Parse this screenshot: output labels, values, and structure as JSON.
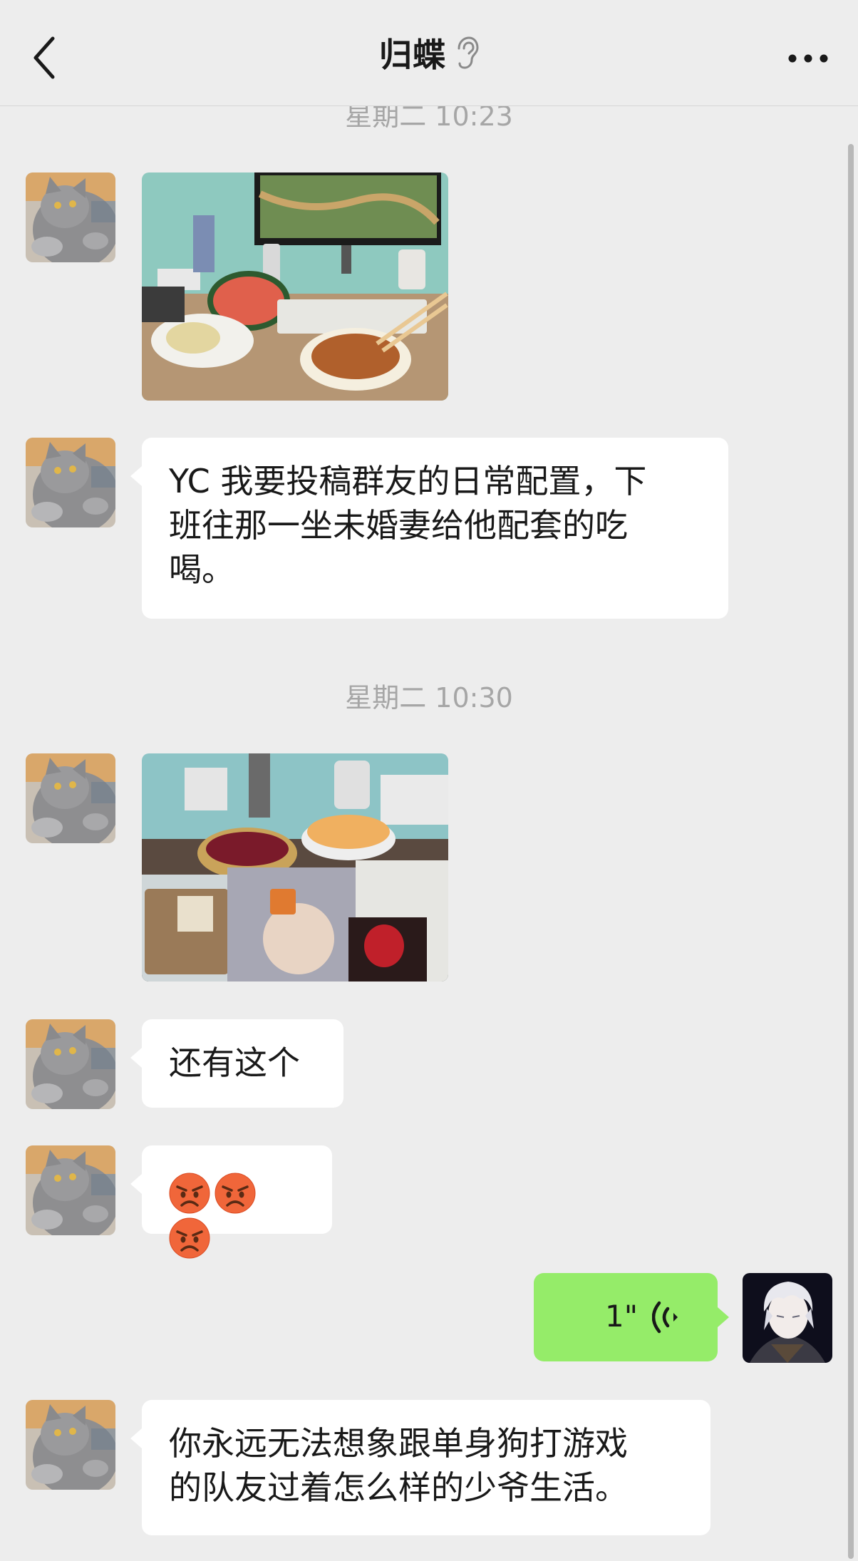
{
  "header": {
    "title": "归蝶",
    "icons": [
      "back-icon",
      "ear-icon",
      "more-icon"
    ]
  },
  "messages": [
    {
      "type": "timestamp",
      "text": "星期二 10:23"
    },
    {
      "type": "image",
      "sender": "other",
      "content": "desk setup with monitor showing game, watermelon and noodles"
    },
    {
      "type": "text",
      "sender": "other",
      "lines": [
        "YC 我要投稿群友的日常配置，下",
        "班往那一坐未婚妻给他配套的吃",
        "喝。"
      ]
    },
    {
      "type": "timestamp",
      "text": "星期二 10:30"
    },
    {
      "type": "image",
      "sender": "other",
      "content": "desk with fruit bowls, melon, keyboard and snacks"
    },
    {
      "type": "text",
      "sender": "other",
      "text": "还有这个"
    },
    {
      "type": "emoji",
      "sender": "other",
      "emoji": [
        "angry-face",
        "angry-face",
        "angry-face"
      ]
    },
    {
      "type": "voice",
      "sender": "me",
      "duration": "1\""
    },
    {
      "type": "text",
      "sender": "other",
      "lines": [
        "你永远无法想象跟单身狗打游戏",
        "的队友过着怎么样的少爷生活。"
      ]
    }
  ],
  "colors": {
    "background": "#ededed",
    "bubble_other": "#ffffff",
    "bubble_me": "#95ec69",
    "timestamp": "#a6a6a6"
  }
}
